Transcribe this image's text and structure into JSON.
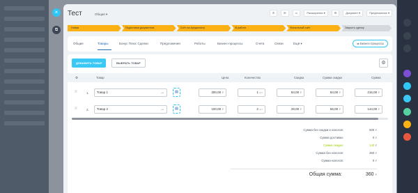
{
  "slider": {
    "title": "Тест",
    "subtitle": "Общая",
    "controls": {
      "extensions": "Расширения",
      "documents": "Документ",
      "suggestion": "Предложение"
    }
  },
  "stages": [
    {
      "label": "Новая",
      "state": "done"
    },
    {
      "label": "Подготовка документов",
      "state": "done"
    },
    {
      "label": "Счёт на предоплату",
      "state": "done"
    },
    {
      "label": "В работе",
      "state": "done"
    },
    {
      "label": "Финальный счёт",
      "state": "done"
    },
    {
      "label": "Закрыть сделку",
      "state": "todo"
    }
  ],
  "tabs": [
    "Общие",
    "Товары",
    "Бонус Плюс Сделки",
    "Предложения",
    "Роботы",
    "Бизнес-процессы",
    "Счета",
    "Связи",
    "Ещё"
  ],
  "tab_active": "Товары",
  "business_processes_button": "Бизнес-процессы",
  "products": {
    "add_button": "ДОБАВИТЬ ТОВАР",
    "choose_button": "ВЫБРАТЬ ТОВАР",
    "columns": {
      "product": "Товар",
      "price": "Цена",
      "quantity": "Количество",
      "discount": "Скидка",
      "discount_sum": "Сумма скидки",
      "sum": "Сумма"
    },
    "rows": [
      {
        "num": "1.",
        "name": "Товар 1",
        "price": "300,00",
        "quantity": "1",
        "unit": "шт",
        "discount": "84,00",
        "discount_sum": "84,00",
        "sum": "216,00"
      },
      {
        "num": "2.",
        "name": "Товар 2",
        "price": "100,00",
        "quantity": "2",
        "unit": "шт",
        "discount": "28,00",
        "discount_sum": "56,00",
        "sum": "144,00"
      }
    ],
    "currency": "₽"
  },
  "summary": [
    {
      "label": "Сумма без скидки и налогов:",
      "value": "500"
    },
    {
      "label": "Сумма доставки:",
      "value": "0"
    },
    {
      "label": "Сумма скидки:",
      "value": "140",
      "highlight": true
    },
    {
      "label": "Сумма без налогов:",
      "value": "360"
    },
    {
      "label": "Сумма налогов:",
      "value": "0"
    }
  ],
  "total": {
    "label": "Общая сумма:",
    "value": "360"
  },
  "colors": {
    "accent": "#2fc6f6",
    "stage_done": "#fbb114",
    "stage_todo": "#d5d9dd",
    "tab_active": "#2067b0",
    "discount_green": "#9dcf00"
  }
}
